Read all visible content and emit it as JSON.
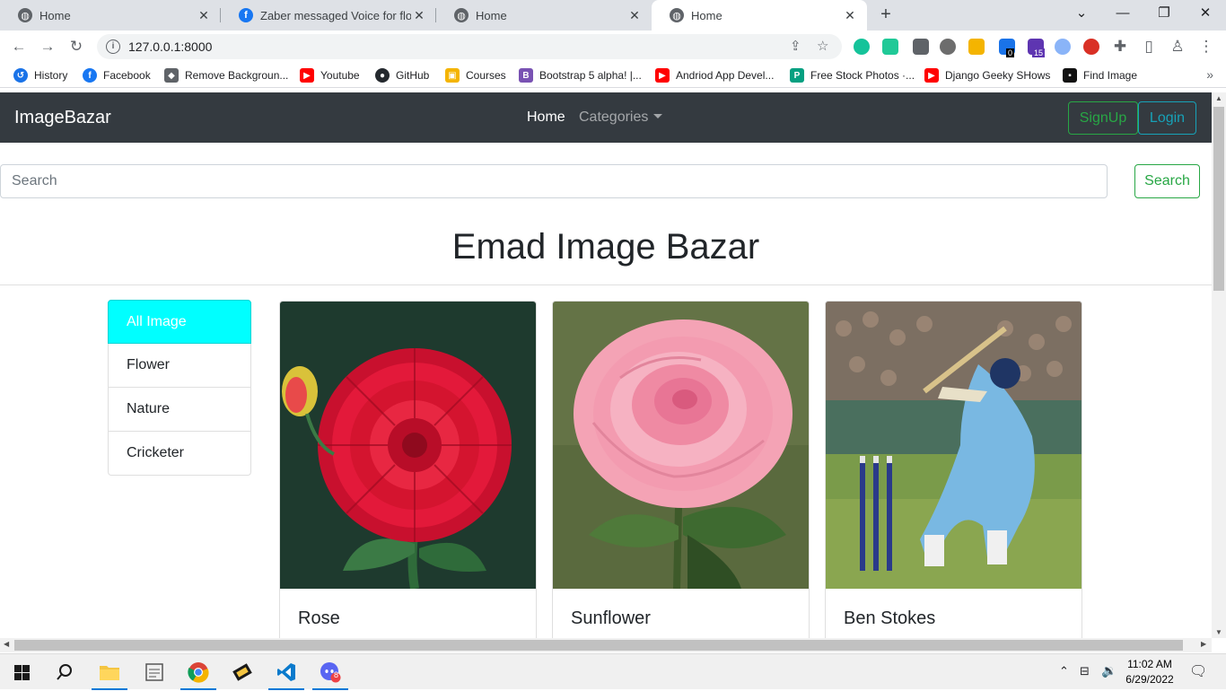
{
  "browser": {
    "tabs": [
      {
        "title": "Home",
        "favicon": "globe-icon",
        "active": false
      },
      {
        "title": "Zaber messaged Voice for flood a",
        "favicon": "facebook-icon",
        "active": false
      },
      {
        "title": "Home",
        "favicon": "globe-icon",
        "active": false
      },
      {
        "title": "Home",
        "favicon": "globe-icon",
        "active": true
      }
    ],
    "url": "127.0.0.1:8000",
    "bookmarks": [
      {
        "label": "History",
        "icon": "history-icon"
      },
      {
        "label": "Facebook",
        "icon": "facebook-icon"
      },
      {
        "label": "Remove Backgroun...",
        "icon": "layers-icon"
      },
      {
        "label": "Youtube",
        "icon": "youtube-icon"
      },
      {
        "label": "GitHub",
        "icon": "github-icon"
      },
      {
        "label": "Courses",
        "icon": "courses-icon"
      },
      {
        "label": "Bootstrap 5 alpha! |...",
        "icon": "bootstrap-icon"
      },
      {
        "label": "Andriod App Devel...",
        "icon": "youtube-icon"
      },
      {
        "label": "Free Stock Photos ·...",
        "icon": "pexels-icon"
      },
      {
        "label": "Django Geeky SHows",
        "icon": "youtube-icon"
      },
      {
        "label": "Find Image",
        "icon": "unsplash-icon"
      }
    ],
    "ext_badges": {
      "first": "0",
      "second": "15"
    }
  },
  "site": {
    "brand": "ImageBazar",
    "nav": {
      "home": "Home",
      "categories": "Categories"
    },
    "signup": "SignUp",
    "login": "Login",
    "search_placeholder": "Search",
    "search_button": "Search",
    "heading": "Emad Image Bazar",
    "categories": [
      "All Image",
      "Flower",
      "Nature",
      "Cricketer"
    ],
    "cards": [
      {
        "title": "Rose"
      },
      {
        "title": "Sunflower"
      },
      {
        "title": "Ben Stokes"
      }
    ]
  },
  "taskbar": {
    "time": "11:02 AM",
    "date": "6/29/2022",
    "discord_badge": "8"
  },
  "colors": {
    "navbar": "#343a40",
    "active_category": "#00ffff",
    "success": "#28a745",
    "info": "#17a2b8"
  }
}
